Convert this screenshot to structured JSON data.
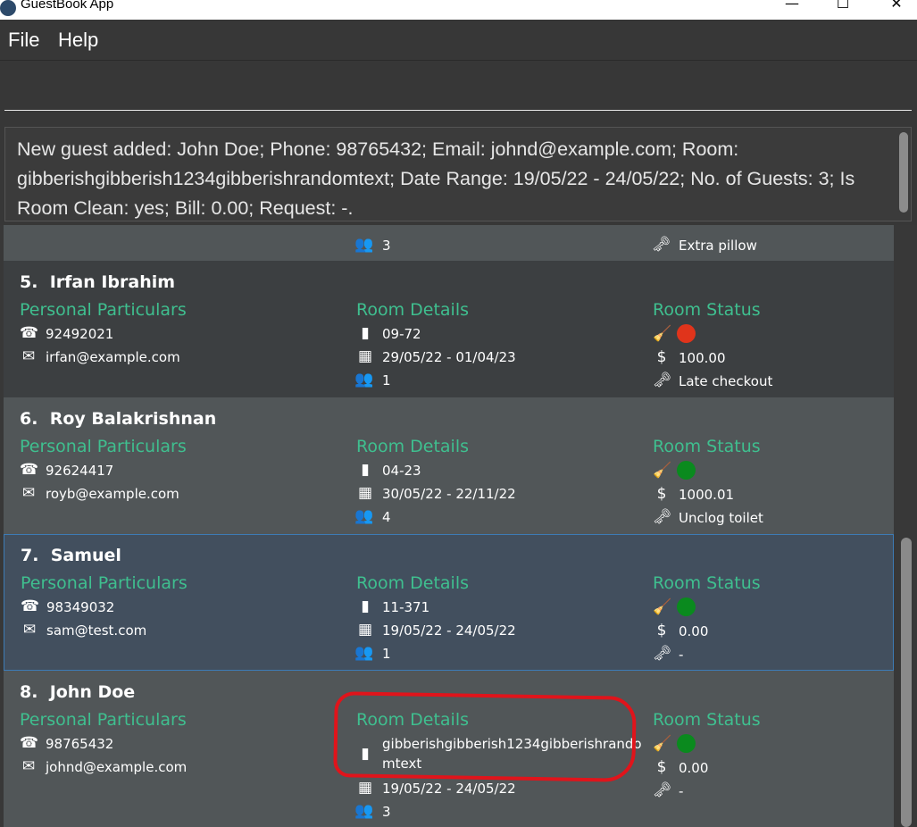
{
  "window": {
    "title": "GuestBook App",
    "minimize": "—",
    "maximize": "☐",
    "close": "✕"
  },
  "menu": [
    "File",
    "Help"
  ],
  "command": {
    "value": ""
  },
  "result": {
    "text": "New guest added: John Doe; Phone: 98765432; Email: johnd@example.com; Room: gibberishgibberish1234gibberishrandomtext; Date Range: 19/05/22 - 24/05/22; No. of Guests: 3; Is Room Clean: yes; Bill: 0.00; Request: -."
  },
  "labels": {
    "personal": "Personal Particulars",
    "room": "Room Details",
    "status": "Room Status"
  },
  "colors": {
    "clean": "#0a8a1e",
    "dirty": "#e0341b",
    "accent": "#3fbf8f"
  },
  "partial_card": {
    "guests": "3",
    "request": "Extra pillow"
  },
  "guests": [
    {
      "index": "5.",
      "name": "Irfan Ibrahim",
      "phone": "92492021",
      "email": "irfan@example.com",
      "room": "09-72",
      "dates": "29/05/22 - 01/04/23",
      "num_guests": "1",
      "clean": false,
      "bill": "100.00",
      "request": "Late checkout"
    },
    {
      "index": "6.",
      "name": "Roy Balakrishnan",
      "phone": "92624417",
      "email": "royb@example.com",
      "room": "04-23",
      "dates": "30/05/22 - 22/11/22",
      "num_guests": "4",
      "clean": true,
      "bill": "1000.01",
      "request": "Unclog toilet"
    },
    {
      "index": "7.",
      "name": "Samuel",
      "phone": "98349032",
      "email": "sam@test.com",
      "room": "11-371",
      "dates": "19/05/22 - 24/05/22",
      "num_guests": "1",
      "clean": true,
      "bill": "0.00",
      "request": "-"
    },
    {
      "index": "8.",
      "name": "John Doe",
      "phone": "98765432",
      "email": "johnd@example.com",
      "room": "gibberishgibberish1234gibberishrando",
      "room_cont": "mtext",
      "dates": "19/05/22 - 24/05/22",
      "num_guests": "3",
      "clean": true,
      "bill": "0.00",
      "request": "-"
    }
  ]
}
